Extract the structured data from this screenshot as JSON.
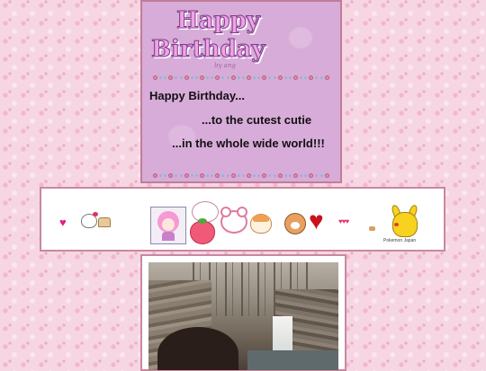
{
  "card": {
    "logo_line1": "Happy",
    "logo_line2": "Birthday",
    "logo_signature": "by ang",
    "message_1": "Happy Birthday...",
    "message_2": "...to the cutest cutie",
    "message_3": "...in the whole wide world!!!"
  },
  "stickers": {
    "small_heart": "♥",
    "big_heart": "♥",
    "tiny_hearts": "♥♥♥",
    "pikachu_caption": "Pokemon Japan"
  },
  "colors": {
    "page_background": "#f7d6e4",
    "card_background": "#d8acd8",
    "frame_border": "#c9889f"
  }
}
